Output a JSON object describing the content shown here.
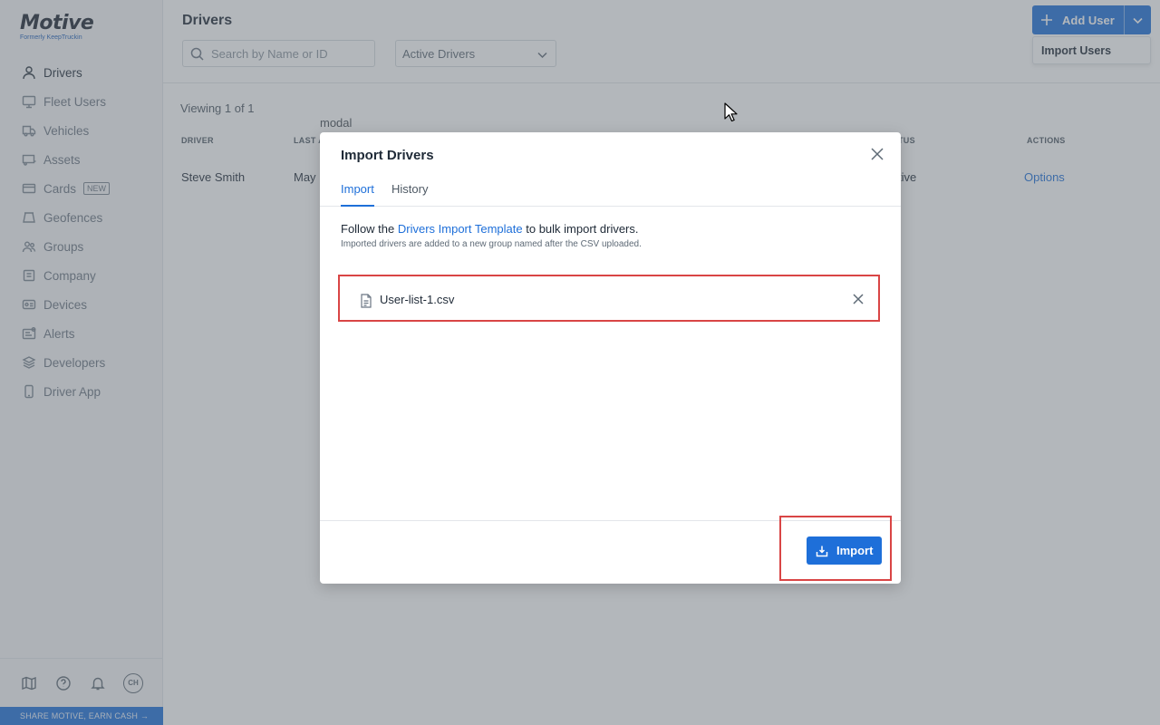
{
  "app": {
    "logo": "Motive",
    "logo_sub": "Formerly KeepTruckin"
  },
  "sidebar": {
    "items": [
      {
        "label": "Drivers",
        "icon": "person-icon",
        "active": true
      },
      {
        "label": "Fleet Users",
        "icon": "monitor-icon"
      },
      {
        "label": "Vehicles",
        "icon": "truck-icon"
      },
      {
        "label": "Assets",
        "icon": "trailer-icon"
      },
      {
        "label": "Cards",
        "icon": "card-icon",
        "badge": "NEW"
      },
      {
        "label": "Geofences",
        "icon": "geofence-icon"
      },
      {
        "label": "Groups",
        "icon": "groups-icon"
      },
      {
        "label": "Company",
        "icon": "building-icon"
      },
      {
        "label": "Devices",
        "icon": "device-icon"
      },
      {
        "label": "Alerts",
        "icon": "alert-icon"
      },
      {
        "label": "Developers",
        "icon": "layers-icon"
      },
      {
        "label": "Driver App",
        "icon": "phone-icon"
      }
    ],
    "footer": {
      "avatar_initials": "CH"
    },
    "share": "SHARE MOTIVE, EARN CASH →"
  },
  "header": {
    "title": "Drivers",
    "search_placeholder": "Search by Name or ID",
    "filter_value": "Active Drivers",
    "add_user": "Add User",
    "dropdown_item": "Import Users"
  },
  "table": {
    "viewing": "Viewing 1 of 1",
    "columns": [
      "DRIVER",
      "LAST A",
      "TUS",
      "ACTIONS"
    ],
    "rows": [
      {
        "driver": "Steve Smith",
        "last": "May",
        "status": "tive",
        "action": "Options"
      }
    ]
  },
  "overlay_label": "modal",
  "modal": {
    "title": "Import Drivers",
    "tabs": [
      "Import",
      "History"
    ],
    "instruction_prefix": "Follow the ",
    "instruction_link": "Drivers Import Template",
    "instruction_suffix": " to bulk import drivers.",
    "sub_instruction": "Imported drivers are added to a new group named after the CSV uploaded.",
    "file_name": "User-list-1.csv",
    "import_button": "Import"
  },
  "colors": {
    "primary": "#1e6fd9",
    "highlight": "#d94545"
  }
}
